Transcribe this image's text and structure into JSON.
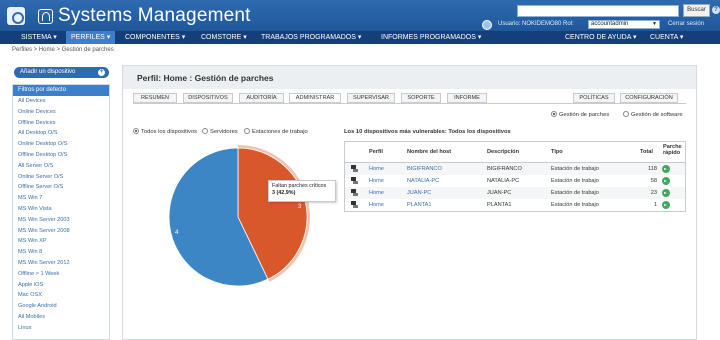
{
  "header": {
    "title": "Systems Management",
    "search_placeholder": "",
    "search_button": "Buscar",
    "help": "?",
    "user_text": "Usuario: NOKIDEMO80  Rol:",
    "role": "accountadmin",
    "logout": "Cerrar sesión"
  },
  "menu": {
    "items": [
      "SISTEMA ▾",
      "PERFILES ▾",
      "COMPONENTES ▾",
      "COMSTORE ▾",
      "TRABAJOS PROGRAMADOS ▾",
      "INFORMES PROGRAMADOS ▾"
    ],
    "right": [
      "CENTRO DE AYUDA ▾",
      "CUENTA ▾"
    ]
  },
  "breadcrumb": "Perfiles > Home > Gestión de parches",
  "sidebar": {
    "add_button": "Añadir un dispositivo",
    "filter_header": "Filtros por defecto",
    "filters": [
      "All Devices",
      "Online Devices",
      "Offline Devices",
      "All Desktop O/S",
      "Online Desktop O/S",
      "Offline Desktop O/S",
      "All Server O/S",
      "Online Server O/S",
      "Offline Server O/S",
      "MS Win 7",
      "MS Win Vista",
      "MS Win Server 2003",
      "MS Win Server 2008",
      "MS Win XP",
      "MS Win 8",
      "MS Win Server 2012",
      "Offline > 1 Week",
      "Apple iOS",
      "Mac OSX",
      "Google Android",
      "All Mobiles",
      "Linux"
    ]
  },
  "main": {
    "title": "Perfil: Home : Gestión de parches",
    "tabs": [
      "RESUMEN",
      "DISPOSITIVOS",
      "AUDITORÍA",
      "ADMINISTRAR",
      "SUPERVISAR",
      "SOPORTE",
      "INFORME"
    ],
    "right_tabs": [
      "POLÍTICAS",
      "CONFIGURACIÓN"
    ],
    "mode_radios": [
      "Gestión de parches",
      "Gestión de software"
    ],
    "device_radios": [
      "Todos los dispositivos",
      "Servidores",
      "Estaciones de trabajo"
    ],
    "table_title": "Los 10 dispositivos más vulnerables: Todos los dispositivos",
    "columns": [
      "Perfil",
      "Nombre del host",
      "Descripción",
      "Tipo",
      "Total",
      "Parche rápido"
    ],
    "rows": [
      {
        "profile": "Home",
        "host": "BIGIFRANCO",
        "desc": "BIGIFRANCO",
        "type": "Estación de trabajo",
        "total": "118"
      },
      {
        "profile": "Home",
        "host": "NATALIA-PC",
        "desc": "NATALIA-PC",
        "type": "Estación de trabajo",
        "total": "58"
      },
      {
        "profile": "Home",
        "host": "JUAN-PC",
        "desc": "JUAN-PC",
        "type": "Estación de trabajo",
        "total": "23"
      },
      {
        "profile": "Home",
        "host": "PLANTA1",
        "desc": "PLANTA1",
        "type": "Estación de trabajo",
        "total": "1"
      }
    ],
    "tooltip_line1": "Faltan parches críticos",
    "tooltip_line2": "3 (42,9%)",
    "pie_label_a": "4",
    "pie_label_b": "3"
  },
  "chart_data": {
    "type": "pie",
    "categories": [
      "",
      "Faltan parches críticos"
    ],
    "values": [
      4,
      3
    ],
    "colors": [
      "#3d86c6",
      "#d9582b"
    ]
  },
  "colors": {
    "brand": "#2f6bb0",
    "menu": "#153f7a",
    "accent": "#3d7fc9",
    "link": "#3a6ea8",
    "go": "#41a85f"
  }
}
